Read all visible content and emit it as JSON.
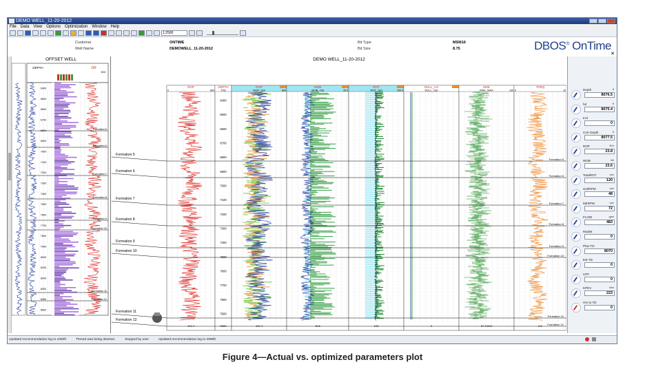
{
  "window": {
    "title": "DEMO WELL_11-20-2012"
  },
  "menu": [
    "File",
    "Data",
    "View",
    "Options",
    "Optimization",
    "Window",
    "Help"
  ],
  "toolbar": {
    "scale_value": "1:2500"
  },
  "info": {
    "customer_label": "Customer",
    "customer_value": "ONTIME",
    "wellname_label": "Well Name",
    "wellname_value": "DEMOWELL_11-20-2012",
    "bittype_label": "Bit Type",
    "bittype_value": "MSI616",
    "bitsize_label": "Bit Size",
    "bitsize_value": "8.75"
  },
  "brand": {
    "name": "DBOS",
    "reg": "®",
    "suffix": " OnTime"
  },
  "offset": {
    "title": "OFFSET WELL",
    "depth_hdr": "DEPTH",
    "gr_hdr": "GR",
    "gr_scale": "300",
    "depths": [
      "6400",
      "6500",
      "6600",
      "6700",
      "6800",
      "6900",
      "7000",
      "7100",
      "7200",
      "7300",
      "7400",
      "7500",
      "7600",
      "7700",
      "7800",
      "7900",
      "8000",
      "8100",
      "8200",
      "8300",
      "8400",
      "8500"
    ],
    "formations": [
      "Formation 5",
      "Formation 6",
      "Formation 7",
      "Formation 8",
      "Formation 9",
      "Formation 10",
      "Formation 11",
      "Formation 12"
    ]
  },
  "main": {
    "title": "DEMO WELL_11-20-2012",
    "tracks": [
      {
        "name": "ROP",
        "scale_lo": "0",
        "scale_hi": "800",
        "foot": "121.4"
      },
      {
        "name": "DEPTH",
        "sub": "TVD",
        "foot": "8080"
      },
      {
        "name": "ROP",
        "sub": "ROP_Opt",
        "scale_hi": "800",
        "foot": "121.4"
      },
      {
        "name": "WOB",
        "sub": "WOB_Opt",
        "scale_hi": "30.0",
        "foot": "16.6"
      },
      {
        "name": "ROT",
        "sub": "ROT_Opt",
        "scale_hi": "200.0",
        "foot": "123"
      },
      {
        "name": "DULL_Act",
        "sub": "DULL_Opt",
        "scale_hi": "",
        "foot": "2"
      },
      {
        "name": "MSE",
        "sub": "MSE_MAX",
        "scale_hi": "100",
        "foot": "37.44913"
      },
      {
        "name": "TORQ",
        "scale_lo": "0",
        "scale_hi": "10",
        "foot": "5.6"
      }
    ],
    "depths": [
      "6400",
      "6500",
      "6600",
      "6700",
      "6800",
      "6900",
      "7000",
      "7100",
      "7200",
      "7300",
      "7400",
      "7500",
      "7600",
      "7700",
      "7800",
      "7900"
    ],
    "formation_labels": [
      "Formation 5",
      "Formation 6",
      "Formation 7",
      "Formation 8",
      "Formation 9",
      "Formation 10",
      "Formation 11",
      "Formation 12"
    ],
    "right_formations": [
      "Formation 5",
      "Formation 6",
      "Formation 7",
      "Formation 8",
      "Formation 9",
      "Formation 10",
      "Formation 11",
      "Formation 12"
    ]
  },
  "gauges": [
    {
      "label": "Depth",
      "unit": "ft",
      "value": "8076.5",
      "icon": "dial-icon"
    },
    {
      "label": "hd",
      "unit": "ft",
      "value": "8075.4",
      "icon": "dial-icon"
    },
    {
      "label": "Incl",
      "unit": "",
      "value": "0",
      "icon": "dial-icon"
    },
    {
      "label": "Corr Depth",
      "unit": "ft",
      "value": "8077.5",
      "icon": "dial-icon"
    },
    {
      "label": "ROP",
      "unit": "ft/hr",
      "value": "23.8",
      "icon": "dial-icon"
    },
    {
      "label": "WOB",
      "unit": "klb",
      "value": "23.6",
      "icon": "dial-icon"
    },
    {
      "label": "TotalROT",
      "unit": "rpm",
      "value": "120",
      "icon": "dial-icon"
    },
    {
      "label": "SurfRPM",
      "unit": "rpm",
      "value": "48",
      "icon": "dial-icon"
    },
    {
      "label": "MtrRPM",
      "unit": "rpm",
      "value": "72",
      "icon": "dial-icon"
    },
    {
      "label": "FLOW",
      "unit": "gpm",
      "value": "483",
      "icon": "dial-icon"
    },
    {
      "label": "Mudwt",
      "unit": "",
      "value": "0",
      "icon": "dial-icon"
    },
    {
      "label": "Plan TD",
      "unit": "",
      "value": "8070",
      "icon": "dial-icon"
    },
    {
      "label": "Est TD",
      "unit": "",
      "value": "0",
      "icon": "dial-icon"
    },
    {
      "label": "CPF",
      "unit": "",
      "value": "0",
      "icon": "dial-icon"
    },
    {
      "label": "KPEV",
      "unit": "kbw",
      "value": "223",
      "icon": "dial-icon"
    },
    {
      "label": "Hrs to TD",
      "unit": "",
      "value": "0",
      "icon": "dial-icon"
    }
  ],
  "status": [
    "Updated recommendation log to 4490ft",
    "Thread was being aborted.",
    "Stopped by user",
    "Updated recommendation log to 3998ft"
  ],
  "caption": "Figure 4—Actual vs. optimized parameters plot",
  "colors": {
    "rop": "#e0221e",
    "wob": "#1f3b9e",
    "rot": "#1b8c2a",
    "mse": "#1a8a1f",
    "torq": "#f08b2e",
    "fill_cyan": "#8fe3f0",
    "fill_orange": "#e98c2c"
  }
}
